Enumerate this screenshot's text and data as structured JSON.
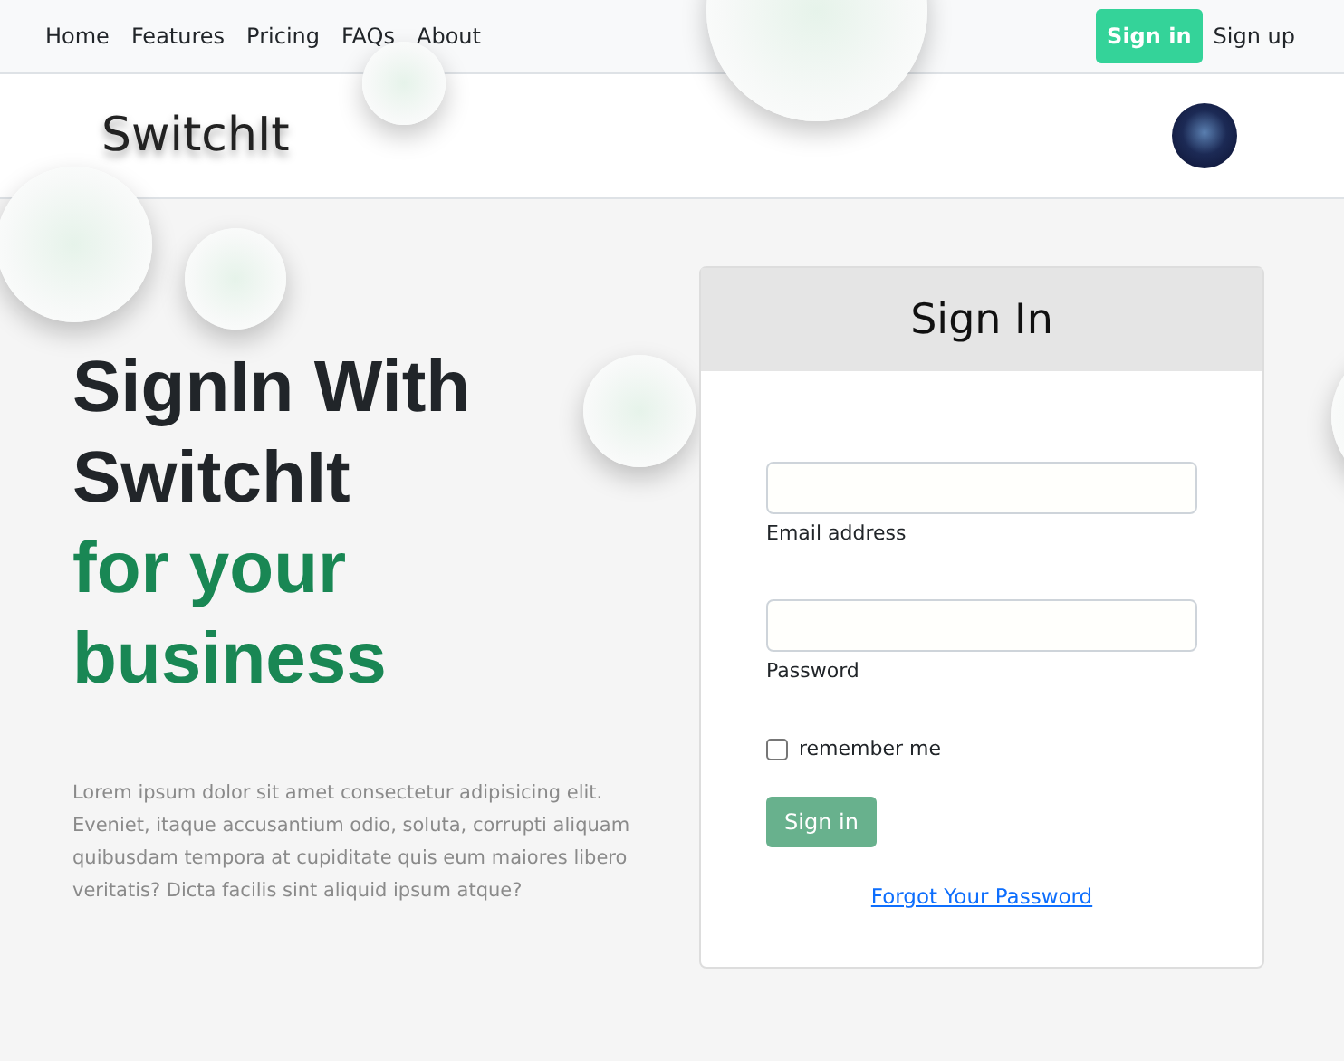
{
  "nav": {
    "links": [
      {
        "label": "Home"
      },
      {
        "label": "Features"
      },
      {
        "label": "Pricing"
      },
      {
        "label": "FAQs"
      },
      {
        "label": "About"
      }
    ],
    "signin": "Sign in",
    "signup": "Sign up"
  },
  "header": {
    "brand": "SwitchIt"
  },
  "hero": {
    "title": "SignIn With SwitchIt",
    "accent": "for your business",
    "text": "Lorem ipsum dolor sit amet consectetur adipisicing elit. Eveniet, itaque accusantium odio, soluta, corrupti aliquam quibusdam tempora at cupiditate quis eum maiores libero veritatis? Dicta facilis sint aliquid ipsum atque?"
  },
  "form": {
    "title": "Sign In",
    "email_label": "Email address",
    "password_label": "Password",
    "remember": {
      "label": "remember me",
      "checked": false
    },
    "submit": "Sign in",
    "forgot": "Forgot Your Password"
  }
}
